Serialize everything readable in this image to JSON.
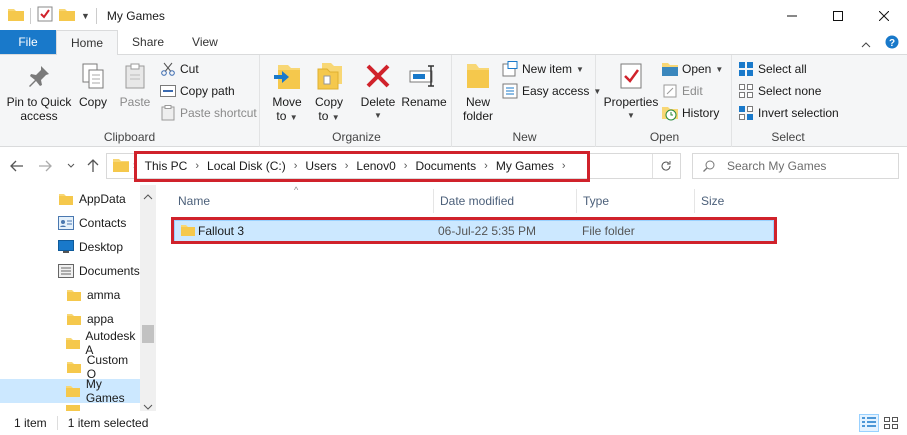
{
  "window": {
    "title": "My Games"
  },
  "tabs": [
    {
      "label": "File"
    },
    {
      "label": "Home"
    },
    {
      "label": "Share"
    },
    {
      "label": "View"
    }
  ],
  "ribbon": {
    "clipboard": {
      "label": "Clipboard",
      "pin": "Pin to Quick\naccess",
      "pin_line1": "Pin to Quick",
      "pin_line2": "access",
      "copy": "Copy",
      "paste": "Paste",
      "cut": "Cut",
      "copy_path": "Copy path",
      "paste_shortcut": "Paste shortcut"
    },
    "organize": {
      "label": "Organize",
      "move_to_1": "Move",
      "move_to_2": "to",
      "copy_to_1": "Copy",
      "copy_to_2": "to",
      "delete": "Delete",
      "rename": "Rename"
    },
    "new": {
      "label": "New",
      "new_folder_1": "New",
      "new_folder_2": "folder",
      "new_item": "New item",
      "easy_access": "Easy access"
    },
    "open": {
      "label": "Open",
      "properties": "Properties",
      "open": "Open",
      "edit": "Edit",
      "history": "History"
    },
    "select": {
      "label": "Select",
      "select_all": "Select all",
      "select_none": "Select none",
      "invert_selection": "Invert selection"
    }
  },
  "address": {
    "crumbs": [
      "This PC",
      "Local Disk (C:)",
      "Users",
      "Lenov0",
      "Documents",
      "My Games"
    ],
    "search_placeholder": "Search My Games"
  },
  "navpane": {
    "items": [
      {
        "label": "AppData",
        "icon": "folder-icon"
      },
      {
        "label": "Contacts",
        "icon": "contacts-icon"
      },
      {
        "label": "Desktop",
        "icon": "desktop-icon"
      },
      {
        "label": "Documents",
        "icon": "documents-icon"
      },
      {
        "label": "amma",
        "icon": "folder-icon"
      },
      {
        "label": "appa",
        "icon": "folder-icon"
      },
      {
        "label": "Autodesk A",
        "icon": "folder-icon"
      },
      {
        "label": "Custom O",
        "icon": "folder-icon"
      },
      {
        "label": "My Games",
        "icon": "folder-icon",
        "selected": true
      }
    ]
  },
  "columns": {
    "name": "Name",
    "date_modified": "Date modified",
    "type": "Type",
    "size": "Size"
  },
  "files": [
    {
      "name": "Fallout 3",
      "date_modified": "06-Jul-22 5:35 PM",
      "type": "File folder",
      "size": ""
    }
  ],
  "status": {
    "item_count": "1 item",
    "selected": "1 item selected"
  },
  "colors": {
    "accent": "#1979ca",
    "selection": "#cce8ff",
    "highlight_box": "#d0222b",
    "folder": "#f8d775"
  }
}
